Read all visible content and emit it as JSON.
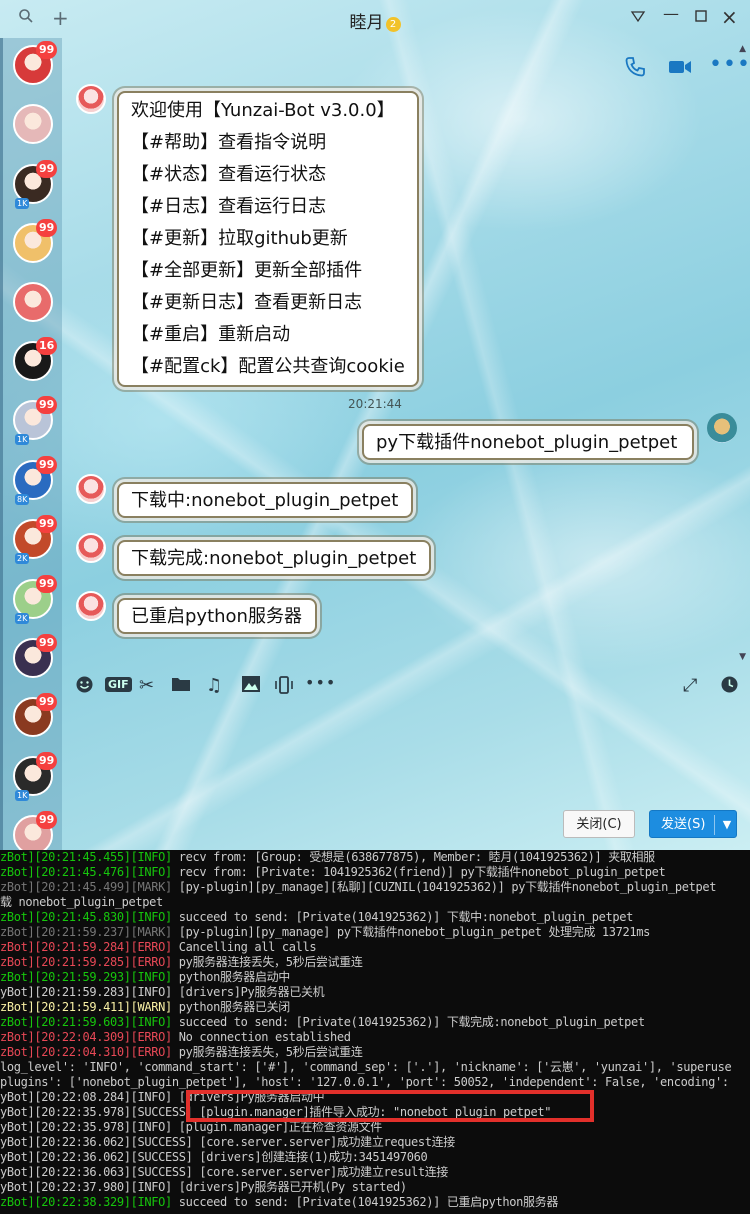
{
  "window": {
    "title": "睦月",
    "vip_badge": "2"
  },
  "sidebar": {
    "items": [
      {
        "badge": "99",
        "level": "",
        "color": "#d73a3a"
      },
      {
        "badge": "",
        "level": "",
        "color": "#e5b8b8"
      },
      {
        "badge": "99",
        "level": "1K",
        "color": "#3a2a22"
      },
      {
        "badge": "99",
        "level": "",
        "color": "#f0c06a"
      },
      {
        "badge": "",
        "level": "",
        "color": "#e86b6b"
      },
      {
        "badge": "16",
        "level": "",
        "color": "#191919"
      },
      {
        "badge": "99",
        "level": "1K",
        "color": "#b9c4d8"
      },
      {
        "badge": "99",
        "level": "8K",
        "color": "#2a6bc0"
      },
      {
        "badge": "99",
        "level": "2K",
        "color": "#c24a2a"
      },
      {
        "badge": "99",
        "level": "2K",
        "color": "#9ccf8a"
      },
      {
        "badge": "99",
        "level": "",
        "color": "#3a3050"
      },
      {
        "badge": "99",
        "level": "",
        "color": "#8a3a20"
      },
      {
        "badge": "99",
        "level": "1K",
        "color": "#2a2a2a"
      },
      {
        "badge": "99",
        "level": "",
        "color": "#e0a0a0"
      }
    ]
  },
  "header_icons": [
    "phone-icon",
    "video-icon",
    "more-icon"
  ],
  "chat": {
    "menu_lines": [
      "欢迎使用【Yunzai-Bot v3.0.0】",
      "【#帮助】查看指令说明",
      "【#状态】查看运行状态",
      "【#日志】查看运行日志",
      "【#更新】拉取github更新",
      "【#全部更新】更新全部插件",
      "【#更新日志】查看更新日志",
      "【#重启】重新启动",
      "【#配置ck】配置公共查询cookie"
    ],
    "time": "20:21:44",
    "my_message": "py下载插件nonebot_plugin_petpet",
    "replies": [
      "下载中:nonebot_plugin_petpet",
      "下载完成:nonebot_plugin_petpet",
      "已重启python服务器"
    ]
  },
  "toolbar": {
    "icons": [
      "emoji-icon",
      "gif-icon",
      "scissors-icon",
      "folder-icon",
      "music-icon",
      "image-icon",
      "shake-icon",
      "more-icon"
    ],
    "gif": "GIF"
  },
  "buttons": {
    "close": "关闭(C)",
    "send": "发送(S)"
  },
  "console": {
    "lines": [
      {
        "p": "zBot][20:21:45.455][INFO]",
        "c": "g",
        "m": " recv from: [Group: 受想是(638677875), Member: 睦月(1041925362)] 夹取相服"
      },
      {
        "p": "zBot][20:21:45.476][INFO]",
        "c": "g",
        "m": " recv from: [Private: 1041925362(friend)] py下载插件nonebot_plugin_petpet"
      },
      {
        "p": "zBot][20:21:45.499][MARK]",
        "c": "d",
        "m": " [py-plugin][py_manage][私聊][CUZNIL(1041925362)] py下载插件nonebot_plugin_petpet"
      },
      {
        "p": "",
        "c": "",
        "m": "载 nonebot_plugin_petpet"
      },
      {
        "p": "zBot][20:21:45.830][INFO]",
        "c": "g",
        "m": " succeed to send: [Private(1041925362)] 下载中:nonebot_plugin_petpet"
      },
      {
        "p": "zBot][20:21:59.237][MARK]",
        "c": "d",
        "m": " [py-plugin][py_manage] py下载插件nonebot_plugin_petpet 处理完成 13721ms"
      },
      {
        "p": "zBot][20:21:59.284][ERRO]",
        "c": "r",
        "m": " Cancelling all calls"
      },
      {
        "p": "zBot][20:21:59.285][ERRO]",
        "c": "r",
        "m": " py服务器连接丢失，5秒后尝试重连"
      },
      {
        "p": "zBot][20:21:59.293][INFO]",
        "c": "g",
        "m": " python服务器启动中"
      },
      {
        "p": "yBot][20:21:59.283][INFO]",
        "c": "",
        "m": " [drivers]Py服务器已关机"
      },
      {
        "p": "zBot][20:21:59.411][WARN]",
        "c": "y",
        "m": " python服务器已关闭"
      },
      {
        "p": "zBot][20:21:59.603][INFO]",
        "c": "g",
        "m": " succeed to send: [Private(1041925362)] 下载完成:nonebot_plugin_petpet"
      },
      {
        "p": "zBot][20:22:04.309][ERRO]",
        "c": "r",
        "m": " No connection established"
      },
      {
        "p": "zBot][20:22:04.310][ERRO]",
        "c": "r",
        "m": " py服务器连接丢失，5秒后尝试重连"
      },
      {
        "p": "",
        "c": "",
        "m": "log_level': 'INFO', 'command_start': ['#'], 'command_sep': ['.'], 'nickname': ['云崽', 'yunzai'], 'superuse"
      },
      {
        "p": "",
        "c": "",
        "m": "plugins': ['nonebot_plugin_petpet'], 'host': '127.0.0.1', 'port': 50052, 'independent': False, 'encoding':"
      },
      {
        "p": "yBot][20:22:08.284][INFO]",
        "c": "",
        "m": " [drivers]Py服务器启动中"
      },
      {
        "p": "yBot][20:22:35.978][SUCCESS]",
        "c": "",
        "m": " [plugin.manager]插件导入成功: \"nonebot_plugin_petpet\""
      },
      {
        "p": "yBot][20:22:35.978][INFO]",
        "c": "",
        "m": " [plugin.manager]正在检查资源文件"
      },
      {
        "p": "yBot][20:22:36.062][SUCCESS]",
        "c": "",
        "m": " [core.server.server]成功建立request连接"
      },
      {
        "p": "yBot][20:22:36.062][SUCCESS]",
        "c": "",
        "m": " [drivers]创建连接(1)成功:3451497060"
      },
      {
        "p": "yBot][20:22:36.063][SUCCESS]",
        "c": "",
        "m": " [core.server.server]成功建立result连接"
      },
      {
        "p": "yBot][20:22:37.980][INFO]",
        "c": "",
        "m": " [drivers]Py服务器已开机(Py started)"
      },
      {
        "p": "zBot][20:22:38.329][INFO]",
        "c": "g",
        "m": " succeed to send: [Private(1041925362)] 已重启python服务器"
      }
    ]
  }
}
